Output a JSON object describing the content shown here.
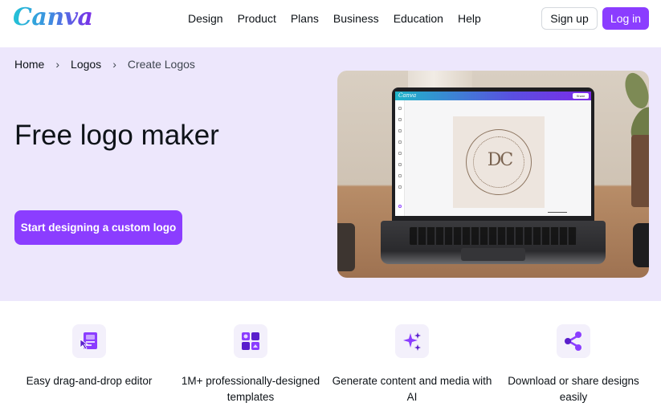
{
  "header": {
    "logo_text": "Canva",
    "nav": [
      "Design",
      "Product",
      "Plans",
      "Business",
      "Education",
      "Help"
    ],
    "signup_label": "Sign up",
    "login_label": "Log in"
  },
  "breadcrumb": {
    "items": [
      "Home",
      "Logos",
      "Create Logos"
    ],
    "separator": "›"
  },
  "hero": {
    "title": "Free logo maker",
    "cta_label": "Start designing a custom logo",
    "image_description_none": ""
  },
  "mockup": {
    "app_logo": "Canva",
    "share_label": "Share",
    "logo_monogram": "DC"
  },
  "features": [
    {
      "icon": "drag-drop-editor-icon",
      "label": "Easy drag-and-drop editor"
    },
    {
      "icon": "templates-icon",
      "label": "1M+ professionally-designed templates"
    },
    {
      "icon": "ai-sparkle-icon",
      "label": "Generate content and media with AI"
    },
    {
      "icon": "share-icon",
      "label": "Download or share designs easily"
    }
  ],
  "colors": {
    "brand_purple": "#8b3dff",
    "hero_background": "#ede7fc",
    "text": "#0e1318"
  }
}
